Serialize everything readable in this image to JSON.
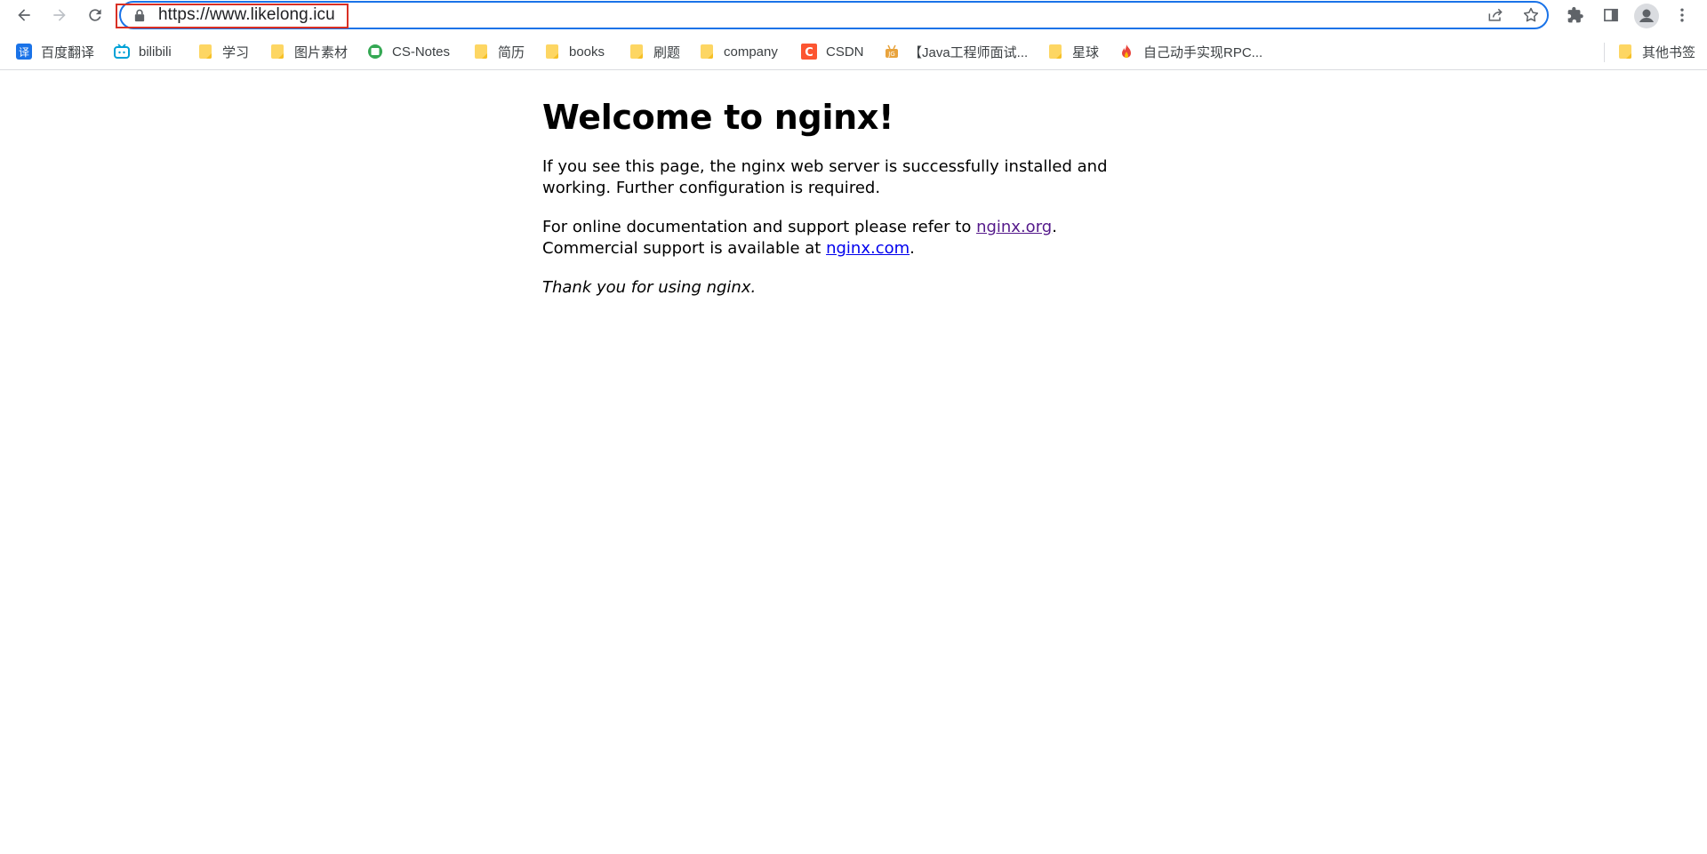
{
  "browser": {
    "url": "https://www.likelong.icu"
  },
  "bookmarks": [
    {
      "label": "百度翻译",
      "icon": "baidu-translate-icon"
    },
    {
      "label": "bilibili",
      "icon": "bilibili-icon"
    },
    {
      "label": "学习",
      "icon": "folder-icon"
    },
    {
      "label": "图片素材",
      "icon": "folder-icon"
    },
    {
      "label": "CS-Notes",
      "icon": "cs-notes-icon"
    },
    {
      "label": "简历",
      "icon": "folder-icon"
    },
    {
      "label": "books",
      "icon": "folder-icon"
    },
    {
      "label": "刷题",
      "icon": "folder-icon"
    },
    {
      "label": "company",
      "icon": "folder-icon"
    },
    {
      "label": "CSDN",
      "icon": "csdn-icon"
    },
    {
      "label": "【Java工程师面试...",
      "icon": "java-icon"
    },
    {
      "label": "星球",
      "icon": "folder-icon"
    },
    {
      "label": "自己动手实现RPC...",
      "icon": "flame-icon"
    }
  ],
  "other_bookmarks": {
    "label": "其他书签",
    "icon": "folder-icon"
  },
  "page": {
    "heading": "Welcome to nginx!",
    "p1": "If you see this page, the nginx web server is successfully installed and working. Further configuration is required.",
    "p2_prefix": "For online documentation and support please refer to ",
    "link1": "nginx.org",
    "p2_mid": ".",
    "p2_line2": "Commercial support is available at ",
    "link2": "nginx.com",
    "p2_end": ".",
    "thanks": "Thank you for using nginx."
  },
  "colors": {
    "omnibox_focus": "#1a73e8",
    "url_highlight": "#d93025",
    "link": "#0000ee",
    "link_visited": "#551a8b",
    "folder": "#fdd663"
  }
}
